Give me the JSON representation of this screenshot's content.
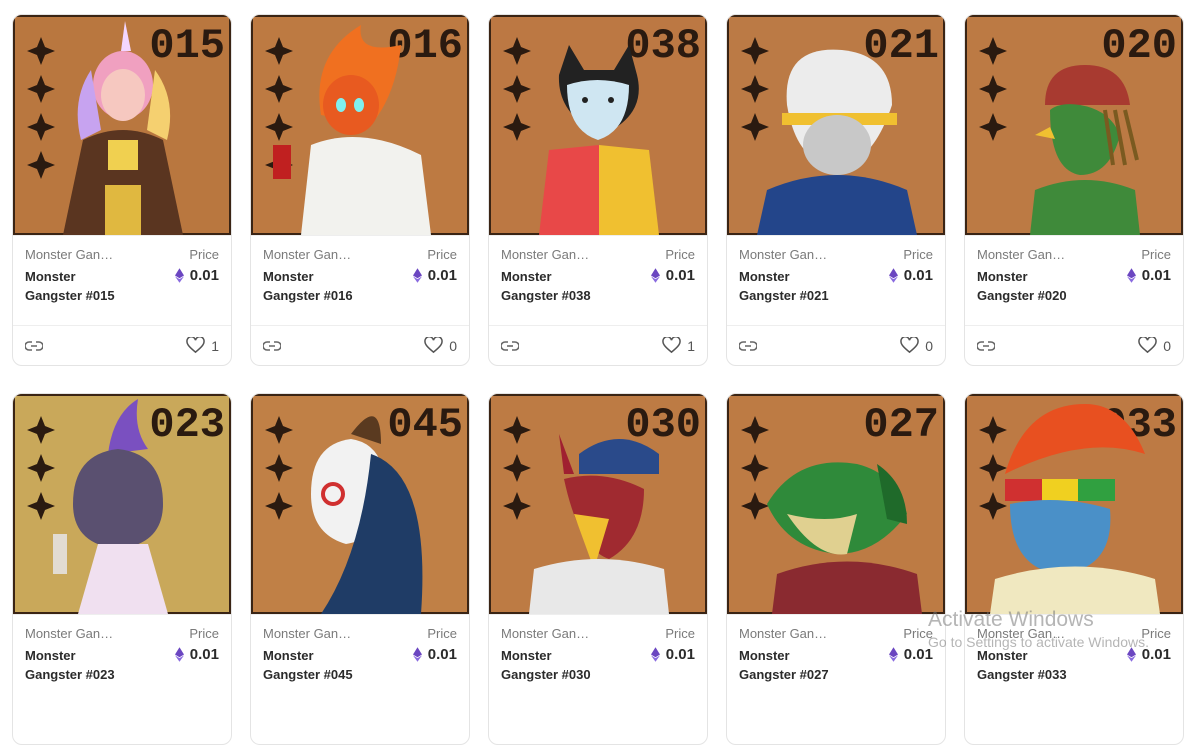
{
  "labels": {
    "price": "Price"
  },
  "cards": [
    {
      "collection": "Monster Gangster",
      "name": "Monster Gangster #015",
      "price": "0.01",
      "likes": "1",
      "number": "015",
      "character": "unicorn-girl",
      "bg": "#b9773f"
    },
    {
      "collection": "Monster Gangster",
      "name": "Monster Gangster #016",
      "price": "0.01",
      "likes": "0",
      "number": "016",
      "character": "fire-head",
      "bg": "#bd7a42"
    },
    {
      "collection": "Monster Gangster",
      "name": "Monster Gangster #038",
      "price": "0.01",
      "likes": "1",
      "number": "038",
      "character": "white-cat",
      "bg": "#bc7843"
    },
    {
      "collection": "Monster Gangster",
      "name": "Monster Gangster #021",
      "price": "0.01",
      "likes": "0",
      "number": "021",
      "character": "monkey-king",
      "bg": "#bb7a45"
    },
    {
      "collection": "Monster Gangster",
      "name": "Monster Gangster #020",
      "price": "0.01",
      "likes": "0",
      "number": "020",
      "character": "green-bird",
      "bg": "#bc7a44"
    },
    {
      "collection": "Monster Gangster",
      "name": "Monster Gangster #023",
      "price": "0.01",
      "likes": "",
      "number": "023",
      "character": "purple-cat",
      "bg": "#c9a85a"
    },
    {
      "collection": "Monster Gangster",
      "name": "Monster Gangster #045",
      "price": "0.01",
      "likes": "",
      "number": "045",
      "character": "masked-goat",
      "bg": "#c08046"
    },
    {
      "collection": "Monster Gangster",
      "name": "Monster Gangster #030",
      "price": "0.01",
      "likes": "",
      "number": "030",
      "character": "red-demon",
      "bg": "#bd7b44"
    },
    {
      "collection": "Monster Gangster",
      "name": "Monster Gangster #027",
      "price": "0.01",
      "likes": "",
      "number": "027",
      "character": "green-dragon",
      "bg": "#bd7b44"
    },
    {
      "collection": "Monster Gangster",
      "name": "Monster Gangster #033",
      "price": "0.01",
      "likes": "",
      "number": "033",
      "character": "blue-rasta",
      "bg": "#bd7a44"
    }
  ],
  "watermark": {
    "line1": "Activate Windows",
    "line2": "Go to Settings to activate Windows."
  }
}
